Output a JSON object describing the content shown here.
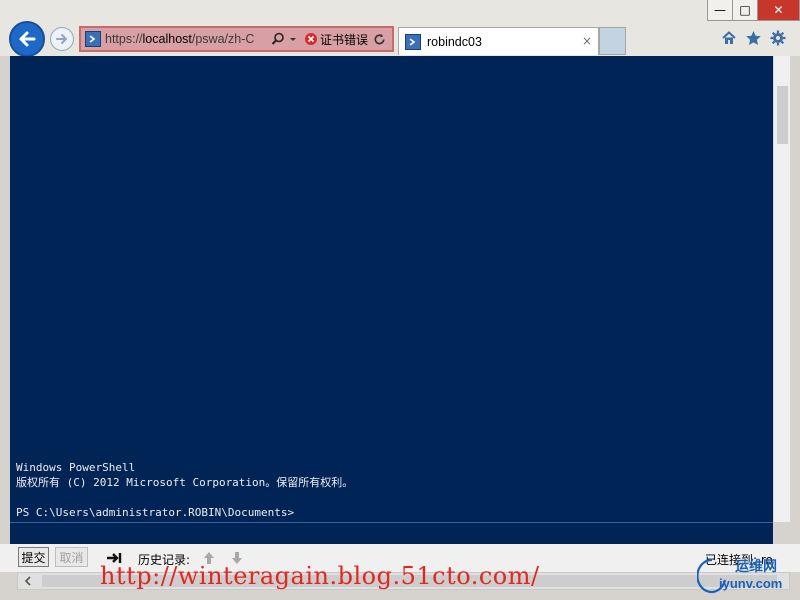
{
  "window": {
    "minimize_label": "—",
    "maximize_label": "□",
    "close_label": "✕"
  },
  "address_bar": {
    "url_prefix": "https://",
    "url_host": "localhost",
    "url_path": "/pswa/zh-C",
    "cert_error": "证书错误"
  },
  "tab": {
    "title": "robindc03",
    "close_label": "×"
  },
  "console": {
    "lines": "Windows PowerShell\n版权所有 (C) 2012 Microsoft Corporation。保留所有权利。\n\nPS C:\\Users\\administrator.ROBIN\\Documents>"
  },
  "toolbar": {
    "submit_label": "提交",
    "cancel_label": "取消",
    "history_label": "历史记录:",
    "status_text": "已连接到: ro"
  },
  "watermark": "http://winteragain.blog.51cto.com/",
  "site_logo": {
    "brand": "运维网",
    "domain": "iyunv.com"
  },
  "colors": {
    "console_bg": "#012456",
    "accent": "#1f68c8",
    "watermark": "#e3261f"
  }
}
